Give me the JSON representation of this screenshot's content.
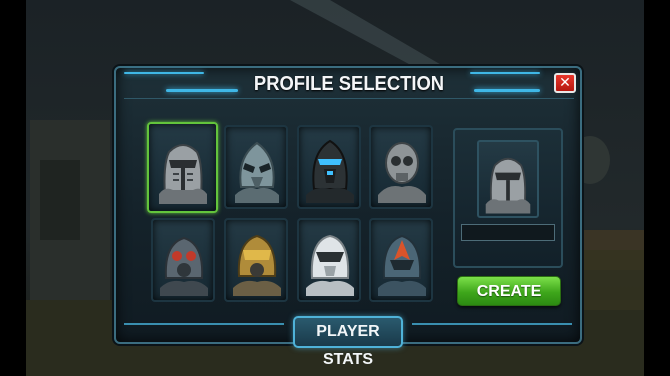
{
  "dialog": {
    "title": "PROFILE SELECTION",
    "close_label": "✕"
  },
  "profiles": [
    {
      "name": "knight-helmet",
      "selected": true
    },
    {
      "name": "blue-alien-helmet",
      "selected": false
    },
    {
      "name": "black-armor-helmet",
      "selected": false
    },
    {
      "name": "grey-robot-helmet",
      "selected": false
    },
    {
      "name": "gas-mask-helmet",
      "selected": false
    },
    {
      "name": "yellow-visor-helmet",
      "selected": false
    },
    {
      "name": "white-trooper-helmet",
      "selected": false
    },
    {
      "name": "orange-visor-helmet",
      "selected": false
    }
  ],
  "preview": {
    "profile": "knight-helmet",
    "name_value": ""
  },
  "buttons": {
    "create": "CREATE",
    "player_stats": "PLAYER STATS"
  },
  "colors": {
    "accent": "#3fb7e6",
    "selected_border": "#63c43c",
    "create_green": "#3ea61b",
    "close_red": "#d8271d"
  }
}
